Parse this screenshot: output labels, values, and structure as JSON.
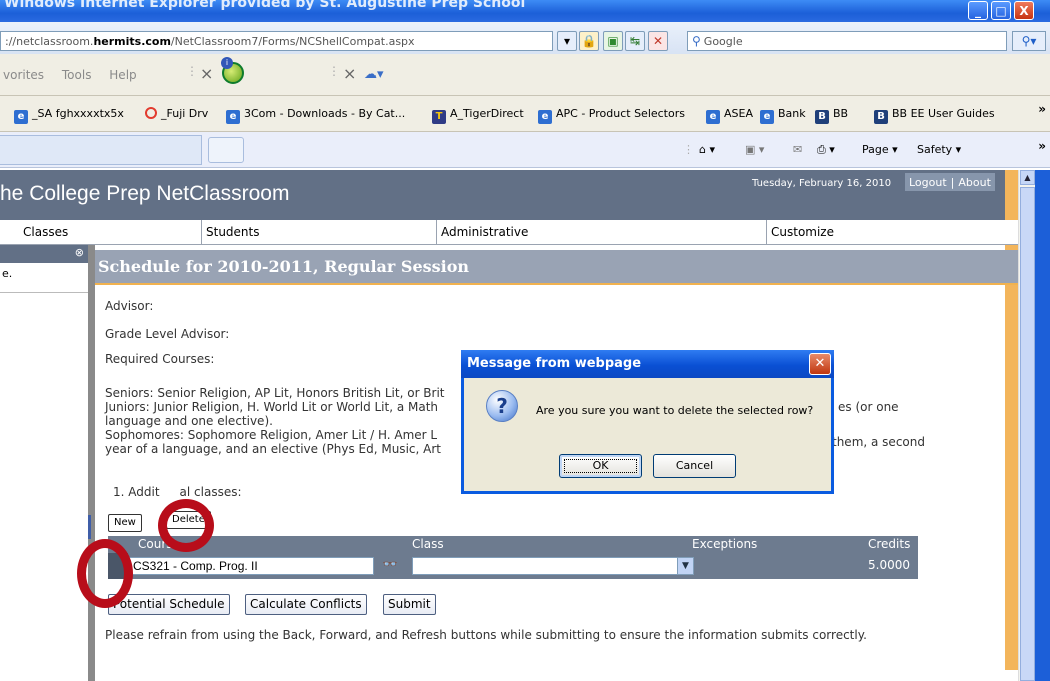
{
  "browser": {
    "title": "Windows Internet Explorer provided by St. Augustine Prep School",
    "window_buttons": {
      "minimize": "_",
      "maximize": "□",
      "close": "X"
    },
    "address_prefix": "://netclassroom.",
    "address_domain": "hermits.com",
    "address_path": "/NetClassroom7/Forms/NCShellCompat.aspx",
    "search_placeholder": "Google",
    "menu": [
      "vorites",
      "Tools",
      "Help"
    ],
    "favorites": [
      {
        "label": "_SA fghxxxxtx5x",
        "icon": "ie-icon"
      },
      {
        "label": "_Fuji Drv",
        "icon": "ring-icon"
      },
      {
        "label": "3Com - Downloads - By Cat...",
        "icon": "ie-icon"
      },
      {
        "label": "A_TigerDirect",
        "icon": "tigerdirect-icon"
      },
      {
        "label": "APC - Product Selectors",
        "icon": "ie-icon"
      },
      {
        "label": "ASEA",
        "icon": "ie-icon"
      },
      {
        "label": "Bank",
        "icon": "ie-icon"
      },
      {
        "label": "BB",
        "icon": "b-icon"
      },
      {
        "label": "BB EE User Guides",
        "icon": "b-icon"
      }
    ],
    "command_bar": {
      "page": "Page",
      "safety": "Safety"
    }
  },
  "app": {
    "brand": "he College Prep NetClassroom",
    "date": "Tuesday, February 16, 2010",
    "logout": "Logout",
    "about": "About",
    "nav_tabs": [
      "Classes",
      "Students",
      "Administrative",
      "Customize"
    ],
    "left_item": "e."
  },
  "schedule": {
    "heading": "Schedule for 2010-2011, Regular Session",
    "advisor_label": "Advisor:",
    "grade_advisor_label": "Grade Level Advisor:",
    "required_label": "Required Courses:",
    "seniors": "Seniors: Senior Religion, AP Lit, Honors British Lit, or Brit",
    "juniors": "Juniors: Junior Religion, H. World Lit or World Lit, a Math",
    "juniors_tail": "es (or one",
    "juniors_cont": "language and one elective).",
    "sophomores": "Sophomores: Sophomore Religion, Amer Lit / H. Amer L",
    "sophomores_tail": "them, a second",
    "sophomores_cont": "year of a language, and an elective (Phys Ed, Music, Art",
    "additional": "1. Addit",
    "additional_tail": "al classes:",
    "new_button": "New",
    "delete_button": "Delete",
    "columns": {
      "course": "Course",
      "class": "Class",
      "exceptions": "Exceptions",
      "credits": "Credits"
    },
    "rows": [
      {
        "course": "CS321 - Comp. Prog. II",
        "class": "",
        "credits": "5.0000"
      }
    ],
    "potential_button": "Potential Schedule",
    "conflicts_button": "Calculate Conflicts",
    "submit_button": "Submit",
    "footer_note": "Please refrain from using the Back, Forward, and Refresh buttons while submitting to ensure the information submits correctly."
  },
  "dialog": {
    "title": "Message from webpage",
    "message": "Are you sure you want to delete the selected row?",
    "ok": "OK",
    "cancel": "Cancel"
  },
  "colors": {
    "header": "#627086",
    "accent": "#f1b24f",
    "annotation": "#b80d1a",
    "dialog_title": "#0a50d4"
  }
}
